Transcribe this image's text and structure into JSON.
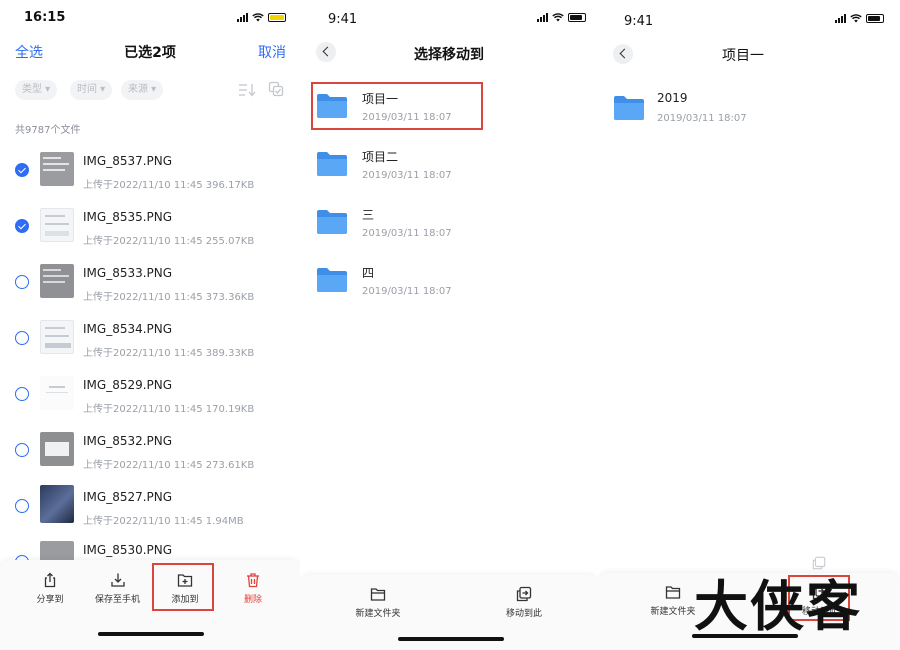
{
  "screen1": {
    "status_time": "16:15",
    "select_all": "全选",
    "title": "已选2项",
    "cancel": "取消",
    "filters": [
      "类型 ▾",
      "时间 ▾",
      "来源 ▾"
    ],
    "file_count": "共9787个文件",
    "files": [
      {
        "name": "IMG_8537.PNG",
        "meta": "上传于2022/11/10 11:45   396.17KB",
        "checked": true
      },
      {
        "name": "IMG_8535.PNG",
        "meta": "上传于2022/11/10 11:45   255.07KB",
        "checked": true
      },
      {
        "name": "IMG_8533.PNG",
        "meta": "上传于2022/11/10 11:45   373.36KB",
        "checked": false
      },
      {
        "name": "IMG_8534.PNG",
        "meta": "上传于2022/11/10 11:45   389.33KB",
        "checked": false
      },
      {
        "name": "IMG_8529.PNG",
        "meta": "上传于2022/11/10 11:45   170.19KB",
        "checked": false
      },
      {
        "name": "IMG_8532.PNG",
        "meta": "上传于2022/11/10 11:45   273.61KB",
        "checked": false
      },
      {
        "name": "IMG_8527.PNG",
        "meta": "上传于2022/11/10 11:45   1.94MB",
        "checked": false
      },
      {
        "name": "IMG_8530.PNG",
        "meta": "",
        "checked": false
      }
    ],
    "toolbar": {
      "share": "分享到",
      "save": "保存至手机",
      "add_to": "添加到",
      "delete": "删除"
    }
  },
  "screen2": {
    "status_time": "9:41",
    "title": "选择移动到",
    "folders": [
      {
        "name": "项目一",
        "date": "2019/03/11 18:07"
      },
      {
        "name": "项目二",
        "date": "2019/03/11 18:07"
      },
      {
        "name": "三",
        "date": "2019/03/11 18:07"
      },
      {
        "name": "四",
        "date": "2019/03/11 18:07"
      }
    ],
    "toolbar": {
      "new_folder": "新建文件夹",
      "move_here": "移动到此"
    }
  },
  "screen3": {
    "status_time": "9:41",
    "title": "项目一",
    "folders": [
      {
        "name": "2019",
        "date": "2019/03/11 18:07"
      }
    ],
    "toolbar": {
      "new_folder": "新建文件夹",
      "move_here": "移动到此"
    },
    "watermark": "大侠客"
  },
  "colors": {
    "accent": "#2f6df5",
    "delete_red": "#e0433b",
    "highlight_box": "#d9473c",
    "folder_blue": "#5aa8f5"
  },
  "icons": [
    "share-icon",
    "download-icon",
    "add-to-icon",
    "trash-icon",
    "folder-icon",
    "new-folder-icon",
    "move-here-icon",
    "back-icon",
    "sort-icon",
    "multi-select-icon"
  ]
}
